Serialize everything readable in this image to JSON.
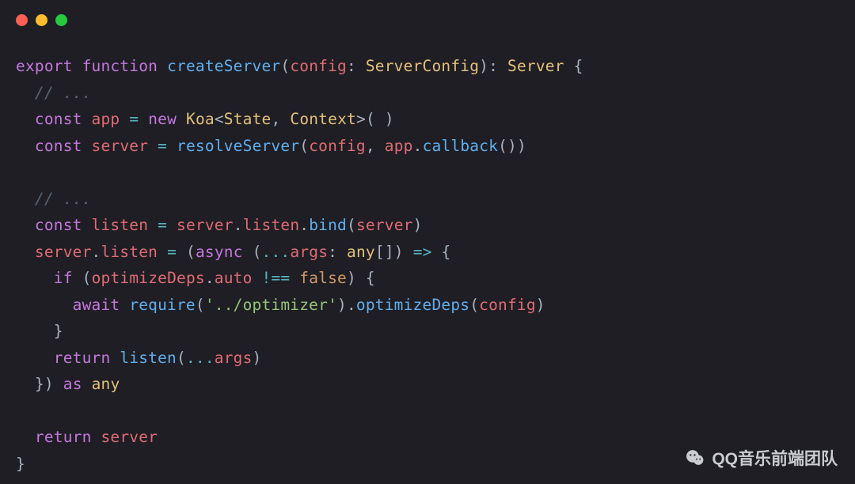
{
  "tokens": {
    "kw_export": "export",
    "kw_function": "function",
    "kw_const": "const",
    "kw_new": "new",
    "kw_return": "return",
    "kw_if": "if",
    "kw_await": "await",
    "kw_as": "as",
    "kw_async": "async",
    "fn_createServer": "createServer",
    "fn_resolveServer": "resolveServer",
    "fn_callback": "callback",
    "fn_bind": "bind",
    "fn_require": "require",
    "fn_optimizeDeps": "optimizeDeps",
    "type_ServerConfig": "ServerConfig",
    "type_Server": "Server",
    "type_Koa": "Koa",
    "type_State": "State",
    "type_Context": "Context",
    "type_any": "any",
    "id_config": "config",
    "id_app": "app",
    "id_server": "server",
    "id_listen": "listen",
    "id_args": "args",
    "id_optimizeDepsVar": "optimizeDeps",
    "prop_listen": "listen",
    "prop_auto": "auto",
    "bool_false": "false",
    "str_optimizer": "'../optimizer'",
    "cmt_ellipsis": "// ...",
    "p_lparen": "(",
    "p_rparen": ")",
    "p_lbrace": "{",
    "p_rbrace": "}",
    "p_lbrack": "[",
    "p_rbrack": "]",
    "p_lt": "<",
    "p_gt": ">",
    "p_colon": ":",
    "p_comma": ",",
    "p_dot": ".",
    "p_space": " ",
    "op_eq": "=",
    "op_neq": "!==",
    "op_arrow": "=>",
    "op_spread": "..."
  },
  "watermark": {
    "text": "QQ音乐前端团队"
  },
  "colors": {
    "bg": "#1e1e24",
    "dot_red": "#ff5f56",
    "dot_yellow": "#ffbd2e",
    "dot_green": "#27c93f"
  }
}
